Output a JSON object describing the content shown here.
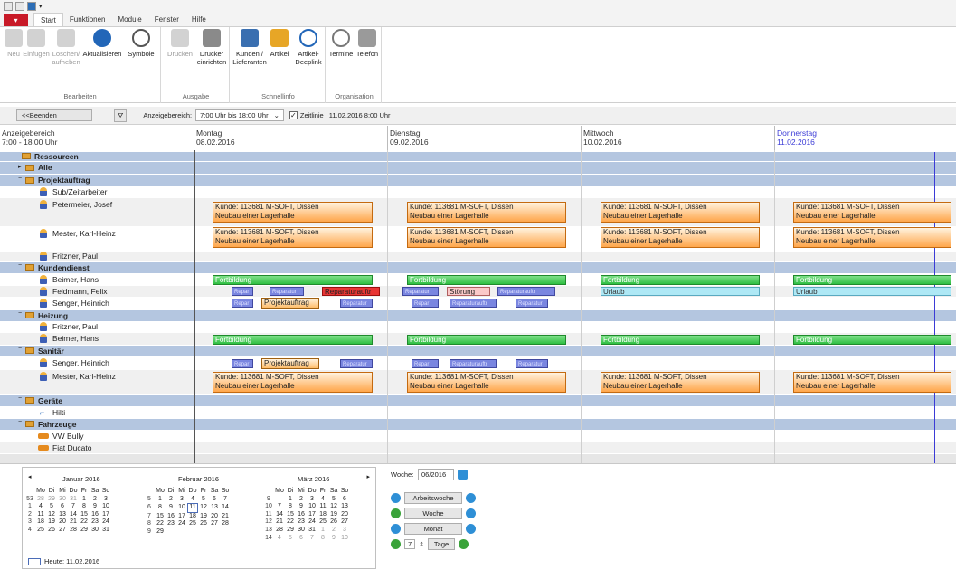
{
  "tabs": {
    "app": "",
    "items": [
      "Start",
      "Funktionen",
      "Module",
      "Fenster",
      "Hilfe"
    ]
  },
  "ribbon": {
    "groups": [
      {
        "label": "Bearbeiten",
        "buttons": [
          "Neu",
          "Einfügen",
          "Löschen/ aufheben",
          "Aktualisieren",
          "Symbole"
        ]
      },
      {
        "label": "Ausgabe",
        "buttons": [
          "Drucken",
          "Drucker einrichten"
        ]
      },
      {
        "label": "Schnellinfo",
        "buttons": [
          "Kunden / Lieferanten",
          "Artikel",
          "Artikel- Deeplink"
        ]
      },
      {
        "label": "Organisation",
        "buttons": [
          "Termine",
          "Telefon"
        ]
      }
    ]
  },
  "toolbar": {
    "back": "<<Beenden",
    "range_label": "Anzeigebereich:",
    "range_value": "7:00 Uhr bis 18:00 Uhr",
    "timeline_checked": "✓",
    "timeline_label": "Zeitlinie",
    "timeline_value": "11.02.2016 8:00 Uhr"
  },
  "scheduler": {
    "range_title": "Anzeigebereich",
    "range_sub": "7:00 - 18:00 Uhr",
    "days": [
      {
        "name": "Montag",
        "date": "08.02.2016"
      },
      {
        "name": "Dienstag",
        "date": "09.02.2016"
      },
      {
        "name": "Mittwoch",
        "date": "10.02.2016"
      },
      {
        "name": "Donnerstag",
        "date": "11.02.2016"
      }
    ],
    "rows": {
      "ressourcen": "Ressourcen",
      "alle": "Alle",
      "projektauftrag": "Projektauftrag",
      "sub": "Sub/Zeitarbeiter",
      "petermeier": "Petermeier, Josef",
      "mester1": "Mester, Karl-Heinz",
      "fritzner1": "Fritzner, Paul",
      "kundendienst": "Kundendienst",
      "beimer1": "Beimer, Hans",
      "feldmann": "Feldmann, Felix",
      "senger1": "Senger, Heinrich",
      "heizung": "Heizung",
      "fritzner2": "Fritzner, Paul",
      "beimer2": "Beimer, Hans",
      "sanitaer": "Sanitär",
      "senger2": "Senger, Heinrich",
      "mester2": "Mester, Karl-Heinz",
      "geraete": "Geräte",
      "hilti": "Hilti",
      "fahrzeuge": "Fahrzeuge",
      "vw": "VW Bully",
      "fiat": "Fiat Ducato"
    },
    "events": {
      "kunde1": "Kunde: 113681 M-SOFT, Dissen",
      "kunde2": "Neubau einer Lagerhalle",
      "fortbildung": "Fortbildung",
      "urlaub": "Urlaub",
      "reparatur": "Reparaturauftr",
      "stoerung": "Störung",
      "projektauftrag": "Projektauftrag",
      "repair_small": "Reparatur",
      "repair_tiny": "Repar",
      "repair_long": "Reparaturauftr"
    }
  },
  "calendar": {
    "months": [
      "Januar 2016",
      "Februar 2016",
      "März 2016"
    ],
    "dow": [
      "Mo",
      "Di",
      "Mi",
      "Do",
      "Fr",
      "Sa",
      "So"
    ],
    "jan": {
      "weeks": [
        "53",
        "1",
        "2",
        "3",
        "4"
      ],
      "rows": [
        [
          "28",
          "29",
          "30",
          "31",
          "1",
          "2",
          "3"
        ],
        [
          "4",
          "5",
          "6",
          "7",
          "8",
          "9",
          "10"
        ],
        [
          "11",
          "12",
          "13",
          "14",
          "15",
          "16",
          "17"
        ],
        [
          "18",
          "19",
          "20",
          "21",
          "22",
          "23",
          "24"
        ],
        [
          "25",
          "26",
          "27",
          "28",
          "29",
          "30",
          "31"
        ]
      ]
    },
    "feb": {
      "weeks": [
        "5",
        "6",
        "7",
        "8",
        "9"
      ],
      "rows": [
        [
          "1",
          "2",
          "3",
          "4",
          "5",
          "6",
          "7"
        ],
        [
          "8",
          "9",
          "10",
          "11",
          "12",
          "13",
          "14"
        ],
        [
          "15",
          "16",
          "17",
          "18",
          "19",
          "20",
          "21"
        ],
        [
          "22",
          "23",
          "24",
          "25",
          "26",
          "27",
          "28"
        ],
        [
          "29",
          "",
          "",
          "",
          "",
          "",
          ""
        ]
      ]
    },
    "mar": {
      "weeks": [
        "9",
        "10",
        "11",
        "12",
        "13",
        "14"
      ],
      "rows": [
        [
          "",
          "1",
          "2",
          "3",
          "4",
          "5",
          "6"
        ],
        [
          "7",
          "8",
          "9",
          "10",
          "11",
          "12",
          "13"
        ],
        [
          "14",
          "15",
          "16",
          "17",
          "18",
          "19",
          "20"
        ],
        [
          "21",
          "22",
          "23",
          "24",
          "25",
          "26",
          "27"
        ],
        [
          "28",
          "29",
          "30",
          "31",
          "1",
          "2",
          "3"
        ],
        [
          "4",
          "5",
          "6",
          "7",
          "8",
          "9",
          "10"
        ]
      ]
    },
    "today": "Heute: 11.02.2016"
  },
  "nav": {
    "woche_label": "Woche:",
    "woche_value": "06/2016",
    "arbeitswoche": "Arbeitswoche",
    "woche": "Woche",
    "monat": "Monat",
    "tage_count": "7",
    "tage": "Tage"
  }
}
